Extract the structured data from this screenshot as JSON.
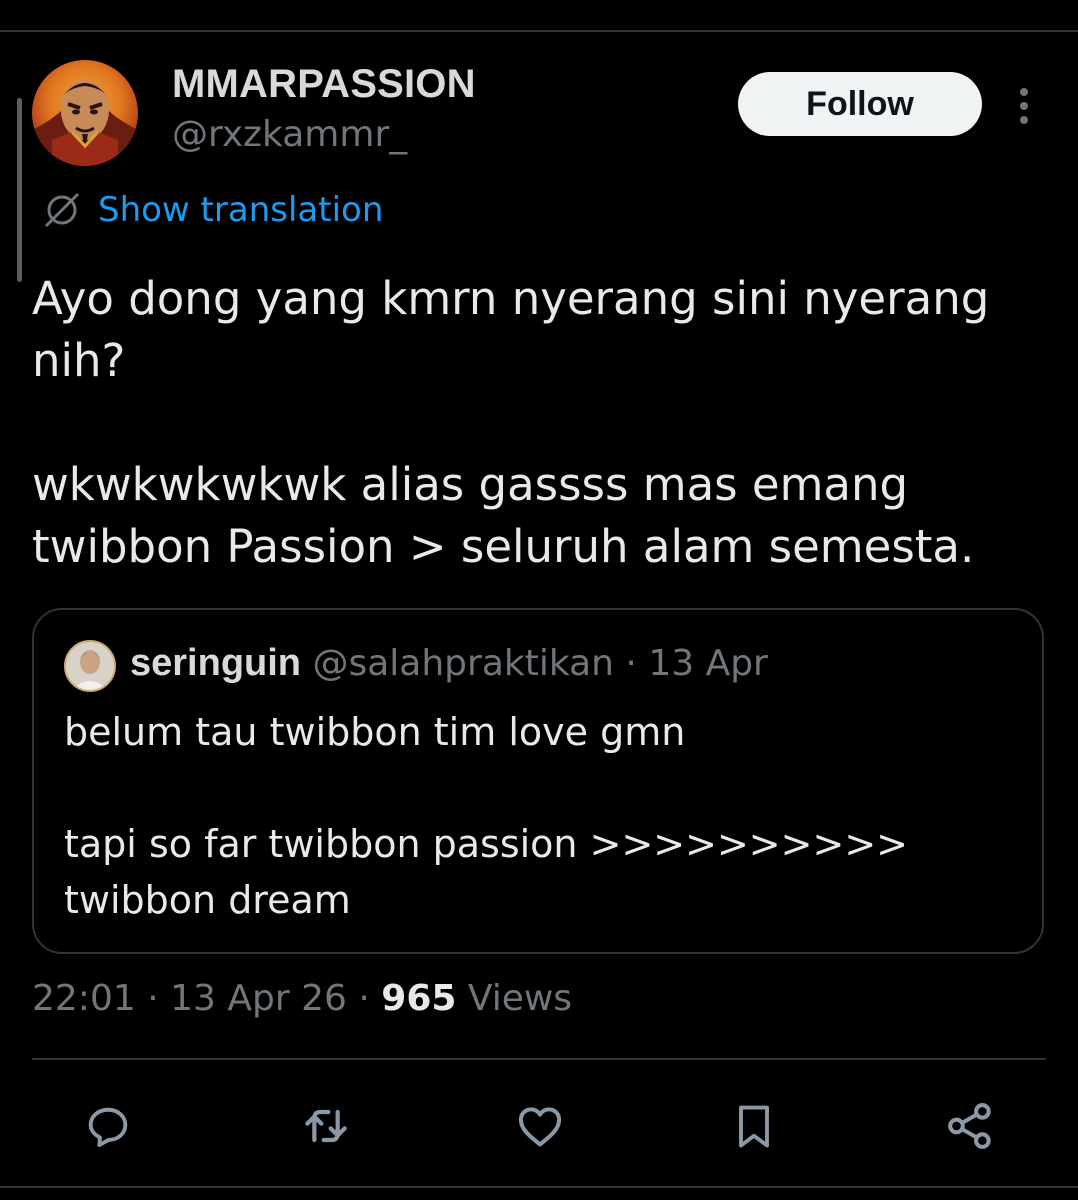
{
  "tweet": {
    "author": {
      "name": "MMARPASSION",
      "handle": "@rxzkammr_"
    },
    "follow_label": "Follow",
    "translate_label": "Show translation",
    "text": {
      "line1": "Ayo dong yang kmrn nyerang sini nyerang nih?",
      "line2": "wkwkwkwkwk alias gassss mas emang twibbon Passion > seluruh alam semesta."
    },
    "quote": {
      "name": "seringuin",
      "handle": "@salahpraktikan",
      "separator": "·",
      "date": "13 Apr",
      "text": {
        "line1": "belum tau twibbon tim love gmn",
        "line2": "tapi so far twibbon passion >>>>>>>>>> twibbon dream"
      }
    },
    "meta": {
      "time": "22:01",
      "sep1": "·",
      "date": "13 Apr 26",
      "sep2": "·",
      "views_count": "965",
      "views_label": "Views"
    },
    "actions": [
      {
        "icon": "reply-icon"
      },
      {
        "icon": "retweet-icon"
      },
      {
        "icon": "like-icon"
      },
      {
        "icon": "bookmark-icon"
      },
      {
        "icon": "share-icon"
      }
    ]
  },
  "colors": {
    "background": "#000000",
    "text": "#e7e9ea",
    "secondary": "#71767b",
    "link": "#1d9bf0",
    "border": "#2f3336",
    "follow_bg": "#eff3f4"
  }
}
